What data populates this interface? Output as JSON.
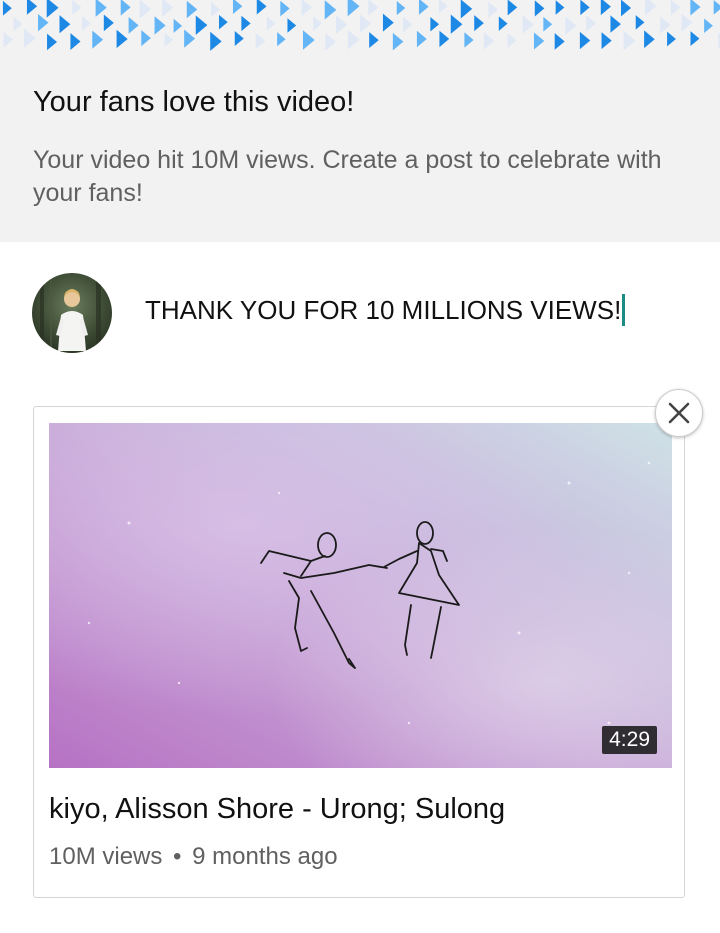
{
  "banner": {
    "title": "Your fans love this video!",
    "subtitle": "Your video hit 10M views. Create a post to celebrate with your fans!",
    "decoration_colors": [
      "#1e88e5",
      "#64b5f6",
      "#e0e8f5"
    ]
  },
  "composer": {
    "avatar_icon": "channel-avatar",
    "text": "THANK YOU FOR 10 MILLIONS VIEWS!",
    "cursor_color": "#1a8c83"
  },
  "attachment": {
    "close_icon": "close-icon",
    "thumbnail_icon": "dancing-couple-sketch",
    "duration": "4:29",
    "title": "kiyo, Alisson Shore - Urong; Sulong",
    "views": "10M views",
    "separator": "•",
    "age": "9 months ago"
  }
}
